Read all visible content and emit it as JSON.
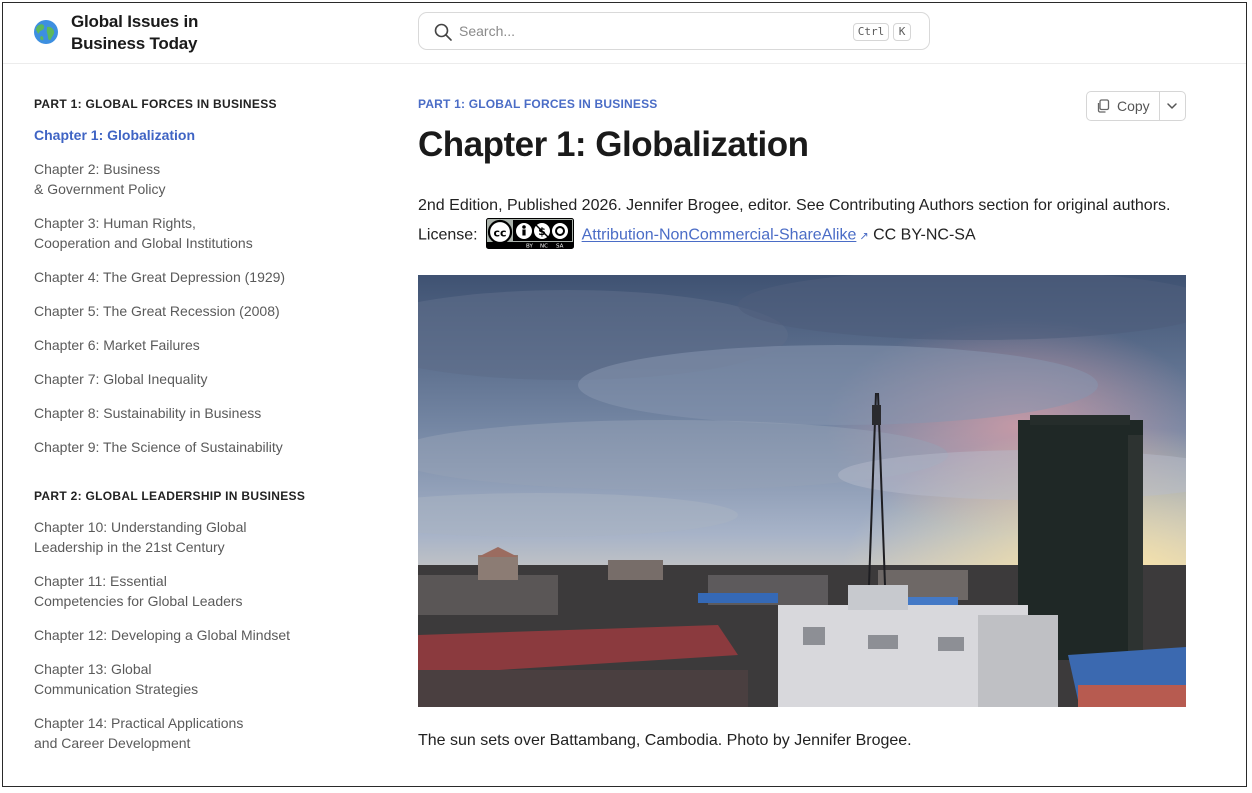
{
  "header": {
    "site_title": "Global Issues in Business Today",
    "logo_icon": "globe-icon",
    "search": {
      "placeholder": "Search...",
      "shortcut_ctrl": "Ctrl",
      "shortcut_key": "K"
    }
  },
  "sidebar": {
    "parts": [
      {
        "heading": "PART 1: GLOBAL FORCES IN BUSINESS",
        "chapters": [
          {
            "label": "Chapter 1: Globalization",
            "active": true
          },
          {
            "label": "Chapter 2: Business & Government Policy",
            "active": false
          },
          {
            "label": "Chapter 3: Human Rights, Cooperation and Global Institutions",
            "active": false
          },
          {
            "label": "Chapter 4: The Great Depression (1929)",
            "active": false
          },
          {
            "label": "Chapter 5: The Great Recession (2008)",
            "active": false
          },
          {
            "label": "Chapter 6: Market Failures",
            "active": false
          },
          {
            "label": "Chapter 7: Global Inequality",
            "active": false
          },
          {
            "label": "Chapter 8: Sustainability in Business",
            "active": false
          },
          {
            "label": "Chapter 9: The Science of Sustainability",
            "active": false
          }
        ]
      },
      {
        "heading": "PART 2: GLOBAL LEADERSHIP IN BUSINESS",
        "chapters": [
          {
            "label": "Chapter 10: Understanding Global Leadership in the 21st Century",
            "active": false
          },
          {
            "label": "Chapter 11: Essential Competencies for Global Leaders",
            "active": false
          },
          {
            "label": "Chapter 12: Developing a Global Mindset",
            "active": false
          },
          {
            "label": "Chapter 13: Global Communication Strategies",
            "active": false
          },
          {
            "label": "Chapter 14: Practical Applications and Career Development",
            "active": false
          }
        ]
      }
    ]
  },
  "main": {
    "breadcrumb": "PART 1: GLOBAL FORCES IN BUSINESS",
    "title": "Chapter 1: Globalization",
    "copy_label": "Copy",
    "meta_text": "2nd Edition, Published 2026. Jennifer Brogee, editor. See Contributing Authors section for original authors. License:",
    "license_link": "Attribution-NonCommercial-ShareAlike",
    "license_code": "CC BY-NC-SA",
    "cc_badge_icon": "cc-by-nc-sa-badge-icon",
    "photo_caption": "The sun sets over Battambang, Cambodia. Photo by Jennifer Brogee."
  },
  "colors": {
    "accent": "#4a6cc6",
    "active_link": "#3f64c4",
    "text": "#222222",
    "muted": "#5a5a5a"
  }
}
